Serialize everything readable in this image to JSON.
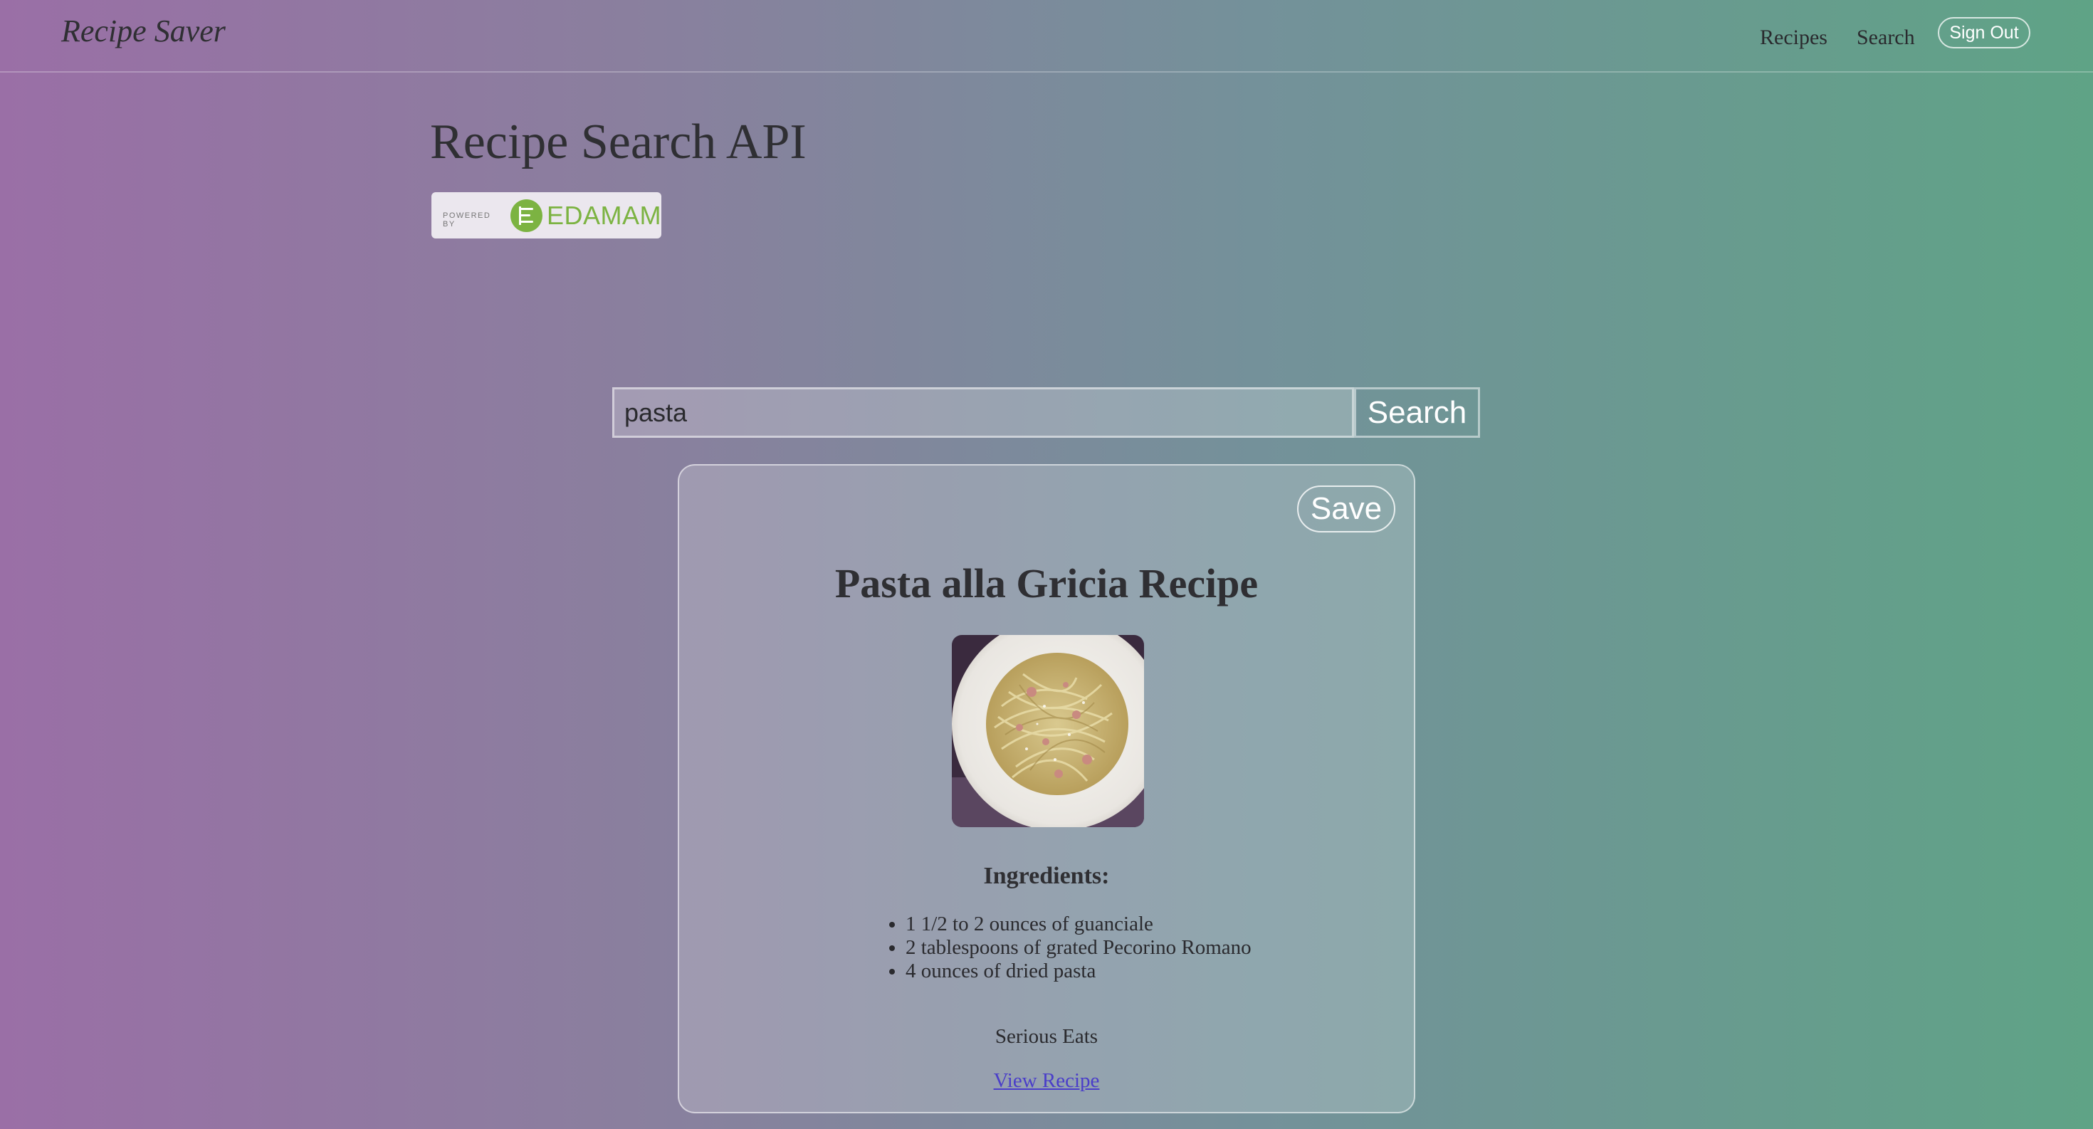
{
  "nav": {
    "brand": "Recipe Saver",
    "links": [
      "Recipes",
      "Search"
    ],
    "sign_out_label": "Sign Out"
  },
  "page": {
    "title": "Recipe Search API",
    "badge": {
      "powered_by": "POWERED BY",
      "brand": "EDAMAM",
      "icon": "edamam-logo-icon"
    }
  },
  "search": {
    "value": "pasta",
    "button_label": "Search"
  },
  "recipe": {
    "save_label": "Save",
    "title": "Pasta alla Gricia Recipe",
    "image_icon": "pasta-dish-image",
    "ingredients_heading": "Ingredients:",
    "ingredients": [
      "1 1/2 to 2 ounces of guanciale",
      "2 tablespoons of grated Pecorino Romano",
      "4 ounces of dried pasta"
    ],
    "source": "Serious Eats",
    "link_label": "View Recipe"
  },
  "colors": {
    "gradient_left": "#9a6fa6",
    "gradient_right": "#5fa386",
    "edamam_green": "#7cb342",
    "link": "#4a3ec9"
  }
}
